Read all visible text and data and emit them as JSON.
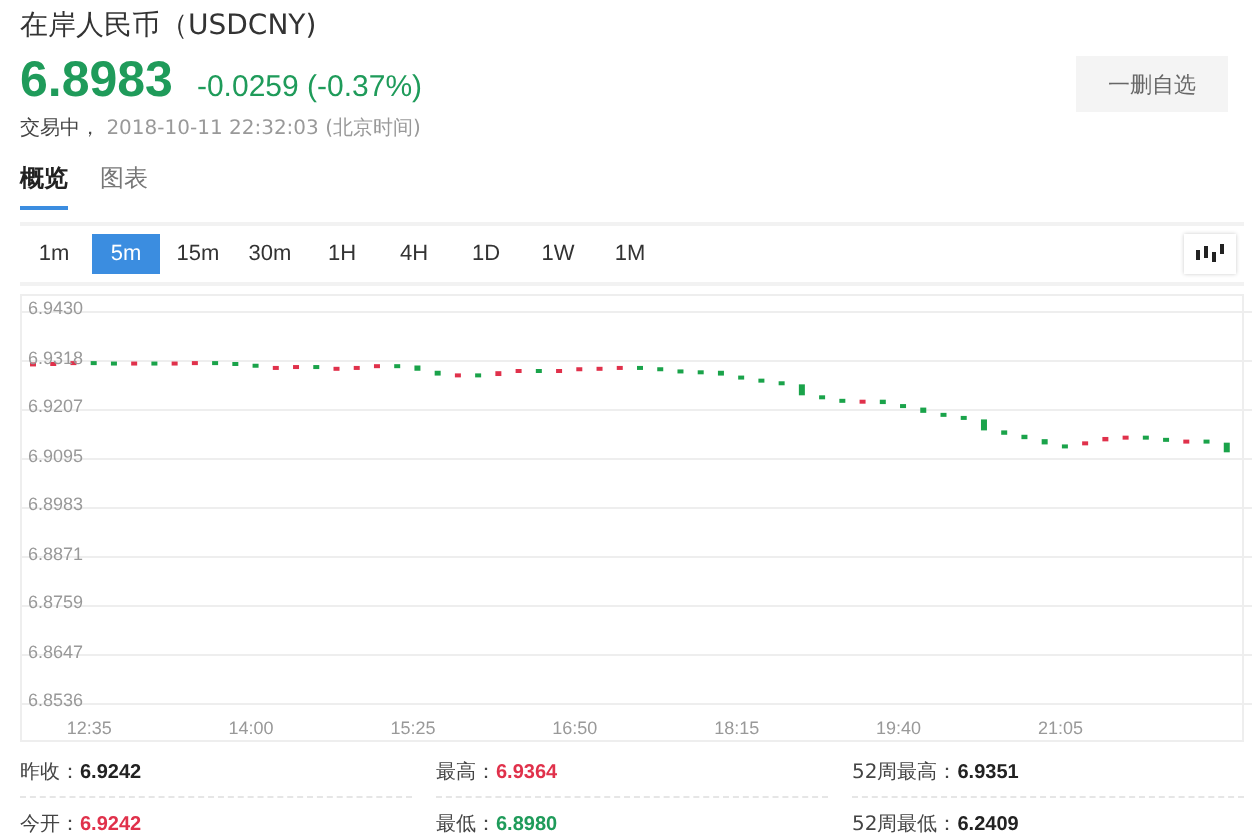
{
  "quote": {
    "title": "在岸人民币（USDCNY)",
    "price": "6.8983",
    "change": "-0.0259 (-0.37%)",
    "status": "交易中，",
    "timestamp": "2018-10-11 22:32:03 (北京时间)",
    "watch_button": "一删自选"
  },
  "tabs": [
    {
      "label": "概览",
      "selected": true
    },
    {
      "label": "图表",
      "selected": false
    }
  ],
  "periods": [
    {
      "label": "1m",
      "selected": false
    },
    {
      "label": "5m",
      "selected": true
    },
    {
      "label": "15m",
      "selected": false
    },
    {
      "label": "30m",
      "selected": false
    },
    {
      "label": "1H",
      "selected": false
    },
    {
      "label": "4H",
      "selected": false
    },
    {
      "label": "1D",
      "selected": false
    },
    {
      "label": "1W",
      "selected": false
    },
    {
      "label": "1M",
      "selected": false
    }
  ],
  "chart": {
    "x_labels": [
      "12:35",
      "14:00",
      "15:25",
      "16:50",
      "18:15",
      "19:40",
      "21:05"
    ],
    "y_labels": [
      "6.9430",
      "6.9318",
      "6.9207",
      "6.9095",
      "6.8983",
      "6.8871",
      "6.8759",
      "6.8647",
      "6.8536"
    ]
  },
  "stats": [
    {
      "label": "昨收：",
      "value": "6.9242",
      "color": "#222222"
    },
    {
      "label": "最高：",
      "value": "6.9364",
      "color": "#e0314b"
    },
    {
      "label": "52周最高：",
      "value": "6.9351",
      "color": "#222222"
    },
    {
      "label": "今开：",
      "value": "6.9242",
      "color": "#e0314b"
    },
    {
      "label": "最低：",
      "value": "6.8980",
      "color": "#1f9b5a"
    },
    {
      "label": "52周最低：",
      "value": "6.2409",
      "color": "#222222"
    }
  ]
}
